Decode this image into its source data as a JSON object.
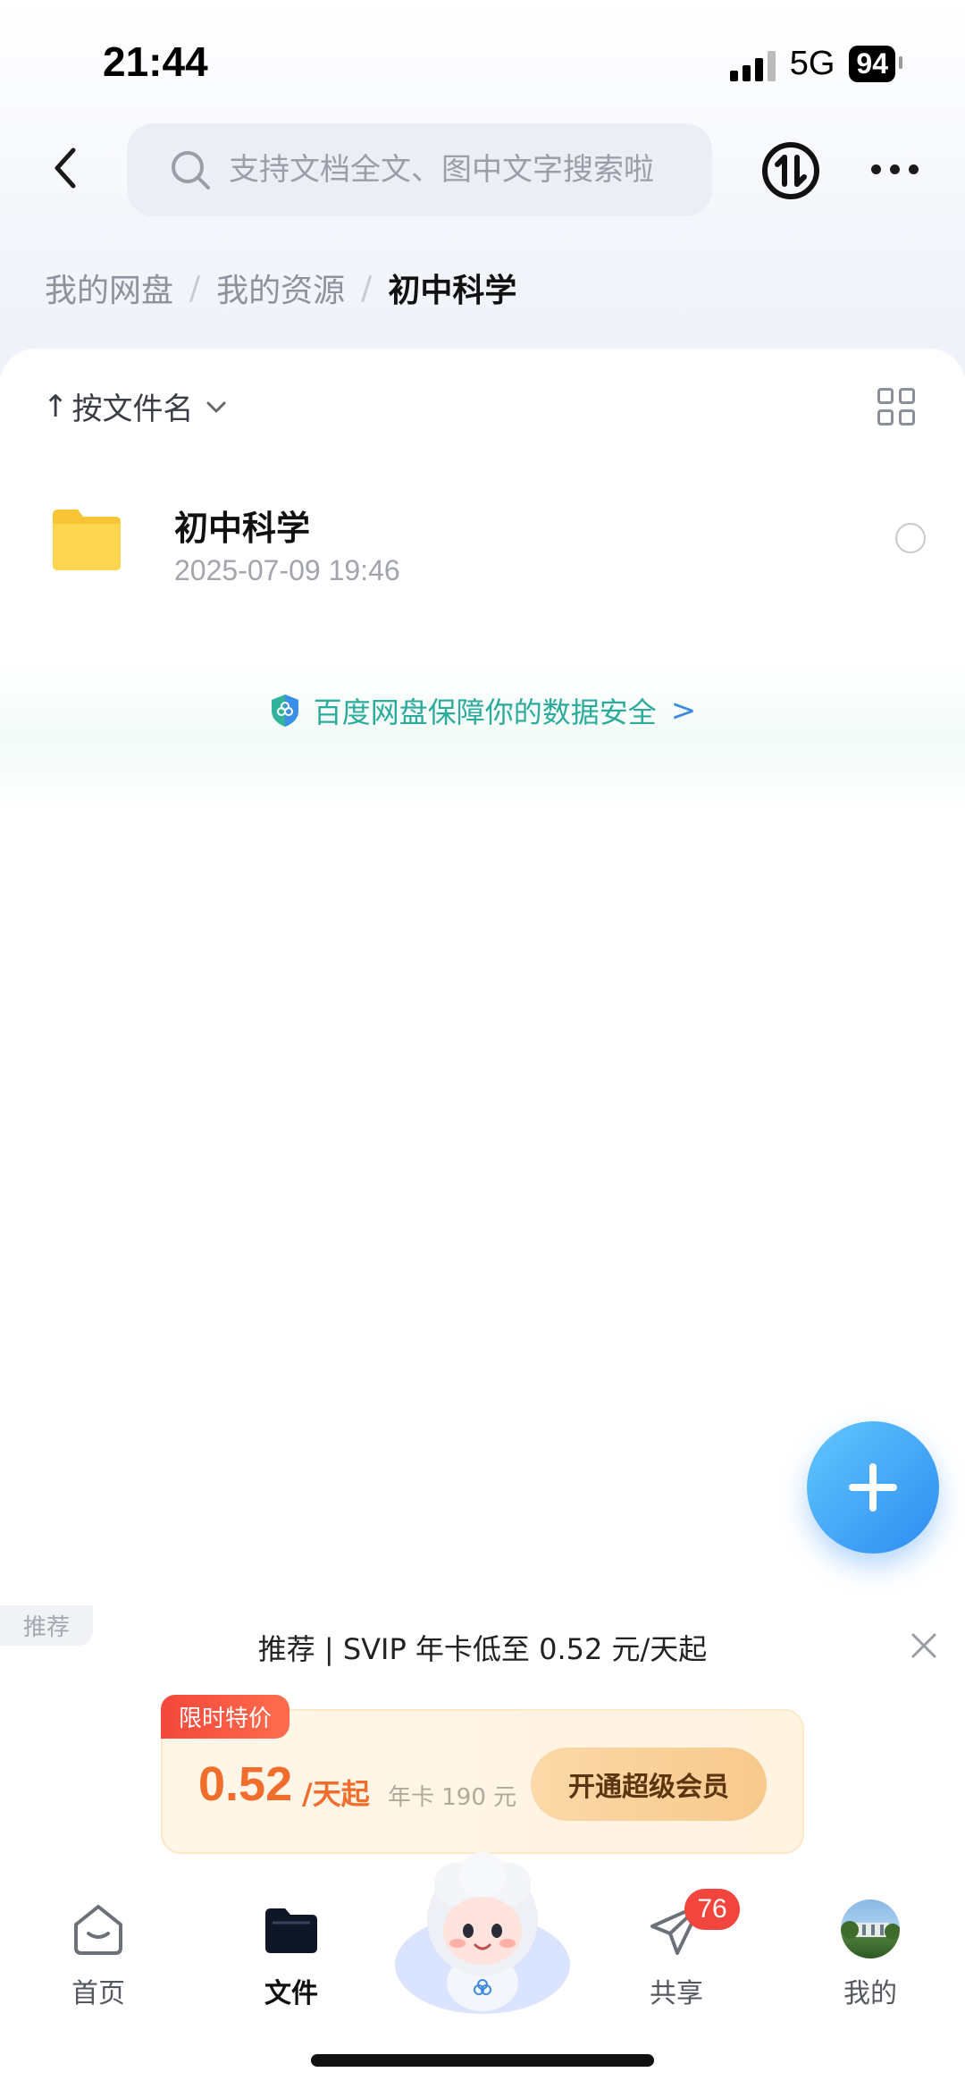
{
  "status_bar": {
    "time": "21:44",
    "network": "5G",
    "battery": "94"
  },
  "header": {
    "search_placeholder": "支持文档全文、图中文字搜索啦"
  },
  "breadcrumb": {
    "items": [
      "我的网盘",
      "我的资源",
      "初中科学"
    ],
    "separator": "/"
  },
  "list": {
    "sort_arrow": "↑",
    "sort_label": "按文件名",
    "files": [
      {
        "name": "初中科学",
        "date": "2025-07-09 19:46",
        "type": "folder"
      }
    ]
  },
  "security_banner": {
    "text": "百度网盘保障你的数据安全",
    "chevron": ">"
  },
  "promo": {
    "tag": "推荐",
    "title": "推荐 | SVIP 年卡低至 0.52 元/天起",
    "badge": "限时特价",
    "price": "0.52",
    "price_unit": "/天起",
    "sub_price": "年卡 190 元",
    "cta": "开通超级会员"
  },
  "bottom_nav": {
    "items": [
      {
        "label": "首页",
        "icon": "home-icon"
      },
      {
        "label": "文件",
        "icon": "folder-icon",
        "active": true
      },
      {
        "label": "共享",
        "icon": "share-icon",
        "badge": "76"
      },
      {
        "label": "我的",
        "icon": "avatar"
      }
    ]
  },
  "colors": {
    "accent": "#2d8cf0",
    "promo_price": "#f06d2c",
    "security_text": "#2bab9c",
    "badge_red": "#f2453d"
  }
}
